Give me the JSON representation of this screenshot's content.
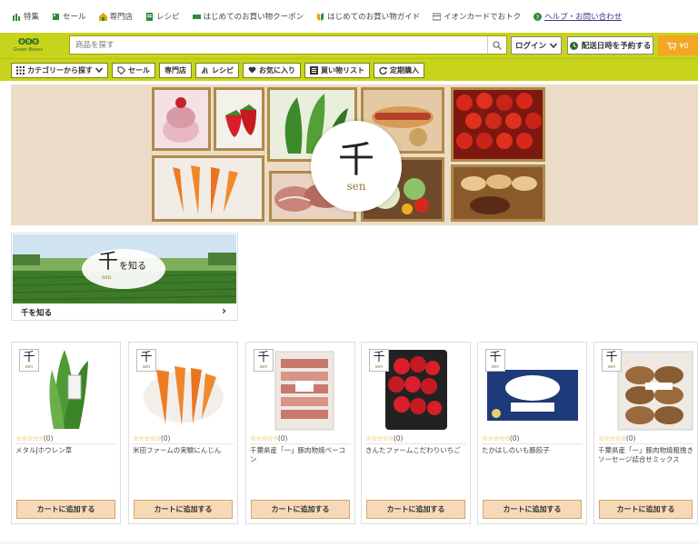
{
  "top_links": [
    {
      "label": "特集",
      "icon": "feature-icon",
      "color": "#2e8b3a"
    },
    {
      "label": "セール",
      "icon": "sale-tag-icon",
      "color": "#2e8b3a"
    },
    {
      "label": "専門店",
      "icon": "shop-icon",
      "color": "#2e8b3a"
    },
    {
      "label": "レシピ",
      "icon": "recipe-icon",
      "color": "#2e8b3a"
    },
    {
      "label": "はじめてのお買い物クーポン",
      "icon": "coupon-icon",
      "color": "#2e8b3a"
    },
    {
      "label": "はじめてのお買い物ガイド",
      "icon": "guide-icon",
      "color": "#e0a800"
    },
    {
      "label": "イオンカードでおトク",
      "icon": "card-icon",
      "color": "#666"
    },
    {
      "label": "ヘルプ・お問い合わせ",
      "icon": "help-icon",
      "color": "#2e8b3a"
    }
  ],
  "header": {
    "logo_text": "Green Beans",
    "search_placeholder": "商品を探す",
    "login_label": "ログイン",
    "delivery_label": "配送日時を予約する",
    "cart_amount": "¥0",
    "accent_color": "#c8d41c"
  },
  "category_nav": [
    {
      "label": "カテゴリーから探す",
      "icon": "grid-icon"
    },
    {
      "label": "セール",
      "icon": "tag-icon"
    },
    {
      "label": "専門店",
      "icon": ""
    },
    {
      "label": "レシピ",
      "icon": "recipe-icon"
    },
    {
      "label": "お気に入り",
      "icon": "heart-icon"
    },
    {
      "label": "買い物リスト",
      "icon": "list-icon"
    },
    {
      "label": "定期購入",
      "icon": "repeat-icon"
    }
  ],
  "hero": {
    "brand_kanji": "千",
    "brand_roman": "sen"
  },
  "know_card": {
    "banner_kanji": "千",
    "banner_text": "を知る",
    "banner_roman": "sen",
    "label": "千を知る"
  },
  "products": [
    {
      "name": "メタルJホウレン草",
      "rating_count": "(0)",
      "button": "カートに追加する"
    },
    {
      "name": "米田ファームの実験にんじん",
      "rating_count": "(0)",
      "button": "カートに追加する"
    },
    {
      "name": "千葉県産「一」豚肉物焼ベーコン",
      "rating_count": "(0)",
      "button": "カートに追加する"
    },
    {
      "name": "きんたファームこだわりいちご",
      "rating_count": "(0)",
      "button": "カートに追加する"
    },
    {
      "name": "たかはしのいも豚餃子",
      "rating_count": "(0)",
      "button": "カートに追加する"
    },
    {
      "name": "千葉県産「一」豚肉物焼粗挽きソーセージ詰合せミックス",
      "rating_count": "(0)",
      "button": "カートに追加する"
    }
  ],
  "badge": {
    "kanji": "千",
    "roman": "sen"
  }
}
